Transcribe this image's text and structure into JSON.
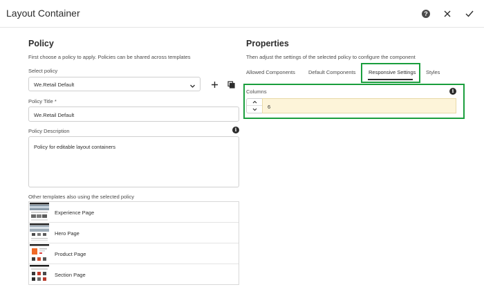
{
  "header": {
    "title": "Layout Container"
  },
  "policy": {
    "heading": "Policy",
    "description": "First choose a policy to apply. Policies can be shared across templates",
    "select_label": "Select policy",
    "select_value": "We.Retail Default",
    "title_label": "Policy Title *",
    "title_value": "We.Retail Default",
    "desc_label": "Policy Description",
    "desc_value": "Policy for editable layout containers",
    "templates_label": "Other templates also using the selected policy",
    "templates": [
      {
        "name": "Experience Page"
      },
      {
        "name": "Hero Page"
      },
      {
        "name": "Product Page"
      },
      {
        "name": "Section Page"
      }
    ]
  },
  "properties": {
    "heading": "Properties",
    "description": "Then adjust the settings of the selected policy to configure the component",
    "tabs": [
      {
        "label": "Allowed Components"
      },
      {
        "label": "Default Components"
      },
      {
        "label": "Responsive Settings"
      },
      {
        "label": "Styles"
      }
    ],
    "columns_label": "Columns",
    "columns_value": "6"
  },
  "colors": {
    "highlight_green": "#1a9e3d",
    "field_yellow": "#fdf4d9"
  },
  "icons": [
    "help-icon",
    "close-icon",
    "check-icon",
    "chevron-down-icon",
    "add-icon",
    "copy-icon",
    "info-icon",
    "chevron-up-icon"
  ]
}
